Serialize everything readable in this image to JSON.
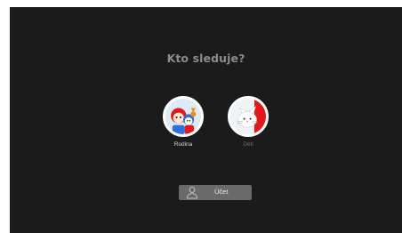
{
  "screen": {
    "title": "Kto sleduje?"
  },
  "profiles": [
    {
      "name": "Rodina",
      "icon": "family-cartoon-avatar-icon",
      "selected": true
    },
    {
      "name": "Děti",
      "icon": "white-cat-avatar-icon",
      "selected": false
    }
  ],
  "account_button": {
    "label": "Účet",
    "icon": "user-icon"
  },
  "colors": {
    "background": "#1b1b1b",
    "title": "#8c8c8c",
    "button": "#6a6a6a",
    "accent_red": "#e0191b"
  }
}
